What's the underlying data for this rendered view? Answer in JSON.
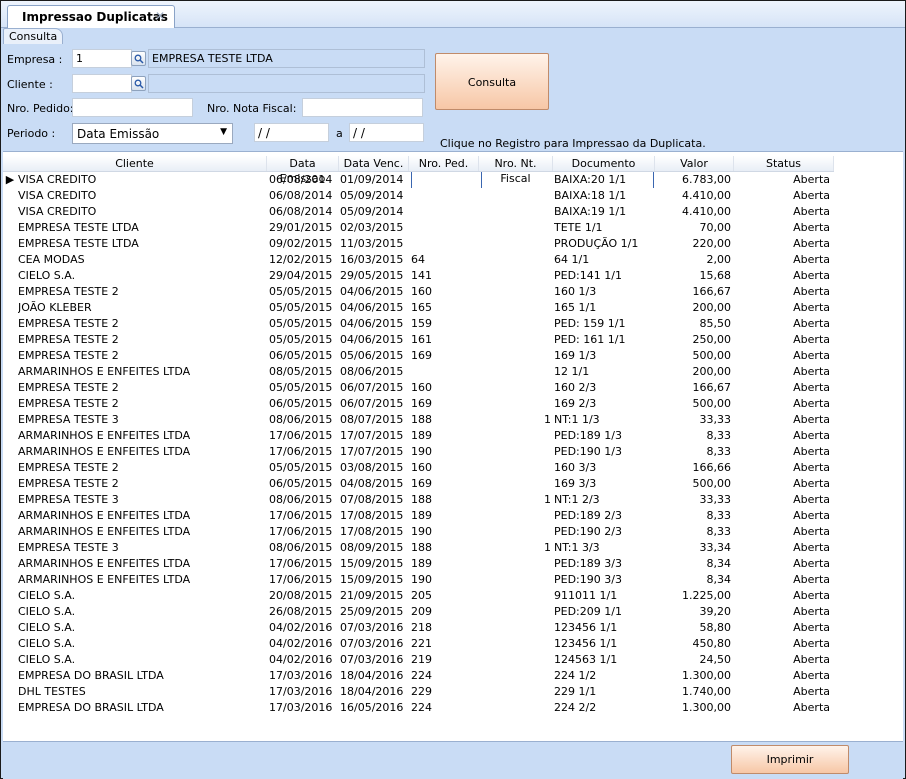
{
  "tab": {
    "title": "Impressao Duplicatas",
    "close": "✕"
  },
  "subtab": "Consulta",
  "form": {
    "empresa_label": "Empresa :",
    "empresa_code": "1",
    "empresa_name": "EMPRESA TESTE LTDA",
    "cliente_label": "Cliente :",
    "cliente_code": "",
    "cliente_name": "",
    "pedido_label": "Nro. Pedido:",
    "pedido_value": "",
    "nf_label": "Nro. Nota Fiscal:",
    "nf_value": "",
    "periodo_label": "Periodo :",
    "periodo_option": "Data Emissão",
    "date_from": "/ /",
    "date_sep": "a",
    "date_to": "/ /",
    "consulta_button": "Consulta",
    "hint": "Clique no Registro para Impressao da Duplicata."
  },
  "grid": {
    "columns": [
      "Cliente",
      "Data Emissao",
      "Data Venc.",
      "Nro. Ped.",
      "Nro. Nt. Fiscal",
      "Documento",
      "Valor",
      "Status"
    ],
    "rows": [
      {
        "cliente": "VISA CREDITO",
        "emissao": "06/08/2014",
        "venc": "01/09/2014",
        "ped": "",
        "nf": "",
        "doc": "BAIXA:20 1/1",
        "valor": "6.783,00",
        "status": "Aberta"
      },
      {
        "cliente": "VISA CREDITO",
        "emissao": "06/08/2014",
        "venc": "05/09/2014",
        "ped": "",
        "nf": "",
        "doc": "BAIXA:18 1/1",
        "valor": "4.410,00",
        "status": "Aberta"
      },
      {
        "cliente": "VISA CREDITO",
        "emissao": "06/08/2014",
        "venc": "05/09/2014",
        "ped": "",
        "nf": "",
        "doc": "BAIXA:19 1/1",
        "valor": "4.410,00",
        "status": "Aberta"
      },
      {
        "cliente": "EMPRESA TESTE LTDA",
        "emissao": "29/01/2015",
        "venc": "02/03/2015",
        "ped": "",
        "nf": "",
        "doc": "TETE 1/1",
        "valor": "70,00",
        "status": "Aberta"
      },
      {
        "cliente": "EMPRESA TESTE LTDA",
        "emissao": "09/02/2015",
        "venc": "11/03/2015",
        "ped": "",
        "nf": "",
        "doc": "PRODUÇÃO 1/1",
        "valor": "220,00",
        "status": "Aberta"
      },
      {
        "cliente": "CEA MODAS",
        "emissao": "12/02/2015",
        "venc": "16/03/2015",
        "ped": "64",
        "nf": "",
        "doc": "64 1/1",
        "valor": "2,00",
        "status": "Aberta"
      },
      {
        "cliente": "CIELO S.A.",
        "emissao": "29/04/2015",
        "venc": "29/05/2015",
        "ped": "141",
        "nf": "",
        "doc": "PED:141 1/1",
        "valor": "15,68",
        "status": "Aberta"
      },
      {
        "cliente": "EMPRESA TESTE 2",
        "emissao": "05/05/2015",
        "venc": "04/06/2015",
        "ped": "160",
        "nf": "",
        "doc": "160 1/3",
        "valor": "166,67",
        "status": "Aberta"
      },
      {
        "cliente": "JOÃO KLEBER",
        "emissao": "05/05/2015",
        "venc": "04/06/2015",
        "ped": "165",
        "nf": "",
        "doc": "165 1/1",
        "valor": "200,00",
        "status": "Aberta"
      },
      {
        "cliente": "EMPRESA TESTE 2",
        "emissao": "05/05/2015",
        "venc": "04/06/2015",
        "ped": "159",
        "nf": "",
        "doc": "PED: 159 1/1",
        "valor": "85,50",
        "status": "Aberta"
      },
      {
        "cliente": "EMPRESA TESTE 2",
        "emissao": "05/05/2015",
        "venc": "04/06/2015",
        "ped": "161",
        "nf": "",
        "doc": "PED: 161 1/1",
        "valor": "250,00",
        "status": "Aberta"
      },
      {
        "cliente": "EMPRESA TESTE 2",
        "emissao": "06/05/2015",
        "venc": "05/06/2015",
        "ped": "169",
        "nf": "",
        "doc": "169 1/3",
        "valor": "500,00",
        "status": "Aberta"
      },
      {
        "cliente": "ARMARINHOS E ENFEITES LTDA",
        "emissao": "08/05/2015",
        "venc": "08/06/2015",
        "ped": "",
        "nf": "",
        "doc": "12 1/1",
        "valor": "200,00",
        "status": "Aberta"
      },
      {
        "cliente": "EMPRESA TESTE 2",
        "emissao": "05/05/2015",
        "venc": "06/07/2015",
        "ped": "160",
        "nf": "",
        "doc": "160 2/3",
        "valor": "166,67",
        "status": "Aberta"
      },
      {
        "cliente": "EMPRESA TESTE 2",
        "emissao": "06/05/2015",
        "venc": "06/07/2015",
        "ped": "169",
        "nf": "",
        "doc": "169 2/3",
        "valor": "500,00",
        "status": "Aberta"
      },
      {
        "cliente": "EMPRESA TESTE 3",
        "emissao": "08/06/2015",
        "venc": "08/07/2015",
        "ped": "188",
        "nf": "1",
        "doc": "NT:1 1/3",
        "valor": "33,33",
        "status": "Aberta"
      },
      {
        "cliente": "ARMARINHOS E ENFEITES LTDA",
        "emissao": "17/06/2015",
        "venc": "17/07/2015",
        "ped": "189",
        "nf": "",
        "doc": "PED:189 1/3",
        "valor": "8,33",
        "status": "Aberta"
      },
      {
        "cliente": "ARMARINHOS E ENFEITES LTDA",
        "emissao": "17/06/2015",
        "venc": "17/07/2015",
        "ped": "190",
        "nf": "",
        "doc": "PED:190 1/3",
        "valor": "8,33",
        "status": "Aberta"
      },
      {
        "cliente": "EMPRESA TESTE 2",
        "emissao": "05/05/2015",
        "venc": "03/08/2015",
        "ped": "160",
        "nf": "",
        "doc": "160 3/3",
        "valor": "166,66",
        "status": "Aberta"
      },
      {
        "cliente": "EMPRESA TESTE 2",
        "emissao": "06/05/2015",
        "venc": "04/08/2015",
        "ped": "169",
        "nf": "",
        "doc": "169 3/3",
        "valor": "500,00",
        "status": "Aberta"
      },
      {
        "cliente": "EMPRESA TESTE 3",
        "emissao": "08/06/2015",
        "venc": "07/08/2015",
        "ped": "188",
        "nf": "1",
        "doc": "NT:1 2/3",
        "valor": "33,33",
        "status": "Aberta"
      },
      {
        "cliente": "ARMARINHOS E ENFEITES LTDA",
        "emissao": "17/06/2015",
        "venc": "17/08/2015",
        "ped": "189",
        "nf": "",
        "doc": "PED:189 2/3",
        "valor": "8,33",
        "status": "Aberta"
      },
      {
        "cliente": "ARMARINHOS E ENFEITES LTDA",
        "emissao": "17/06/2015",
        "venc": "17/08/2015",
        "ped": "190",
        "nf": "",
        "doc": "PED:190 2/3",
        "valor": "8,33",
        "status": "Aberta"
      },
      {
        "cliente": "EMPRESA TESTE 3",
        "emissao": "08/06/2015",
        "venc": "08/09/2015",
        "ped": "188",
        "nf": "1",
        "doc": "NT:1 3/3",
        "valor": "33,34",
        "status": "Aberta"
      },
      {
        "cliente": "ARMARINHOS E ENFEITES LTDA",
        "emissao": "17/06/2015",
        "venc": "15/09/2015",
        "ped": "189",
        "nf": "",
        "doc": "PED:189 3/3",
        "valor": "8,34",
        "status": "Aberta"
      },
      {
        "cliente": "ARMARINHOS E ENFEITES LTDA",
        "emissao": "17/06/2015",
        "venc": "15/09/2015",
        "ped": "190",
        "nf": "",
        "doc": "PED:190 3/3",
        "valor": "8,34",
        "status": "Aberta"
      },
      {
        "cliente": "CIELO S.A.",
        "emissao": "20/08/2015",
        "venc": "21/09/2015",
        "ped": "205",
        "nf": "",
        "doc": "911011 1/1",
        "valor": "1.225,00",
        "status": "Aberta"
      },
      {
        "cliente": "CIELO S.A.",
        "emissao": "26/08/2015",
        "venc": "25/09/2015",
        "ped": "209",
        "nf": "",
        "doc": "PED:209 1/1",
        "valor": "39,20",
        "status": "Aberta"
      },
      {
        "cliente": "CIELO S.A.",
        "emissao": "04/02/2016",
        "venc": "07/03/2016",
        "ped": "218",
        "nf": "",
        "doc": "123456 1/1",
        "valor": "58,80",
        "status": "Aberta"
      },
      {
        "cliente": "CIELO S.A.",
        "emissao": "04/02/2016",
        "venc": "07/03/2016",
        "ped": "221",
        "nf": "",
        "doc": "123456 1/1",
        "valor": "450,80",
        "status": "Aberta"
      },
      {
        "cliente": "CIELO S.A.",
        "emissao": "04/02/2016",
        "venc": "07/03/2016",
        "ped": "219",
        "nf": "",
        "doc": "124563 1/1",
        "valor": "24,50",
        "status": "Aberta"
      },
      {
        "cliente": "EMPRESA DO BRASIL LTDA",
        "emissao": "17/03/2016",
        "venc": "18/04/2016",
        "ped": "224",
        "nf": "",
        "doc": "224 1/2",
        "valor": "1.300,00",
        "status": "Aberta"
      },
      {
        "cliente": "DHL TESTES",
        "emissao": "17/03/2016",
        "venc": "18/04/2016",
        "ped": "229",
        "nf": "",
        "doc": "229 1/1",
        "valor": "1.740,00",
        "status": "Aberta"
      },
      {
        "cliente": "EMPRESA DO BRASIL LTDA",
        "emissao": "17/03/2016",
        "venc": "16/05/2016",
        "ped": "224",
        "nf": "",
        "doc": "224 2/2",
        "valor": "1.300,00",
        "status": "Aberta"
      }
    ]
  },
  "imprimir_button": "Imprimir"
}
